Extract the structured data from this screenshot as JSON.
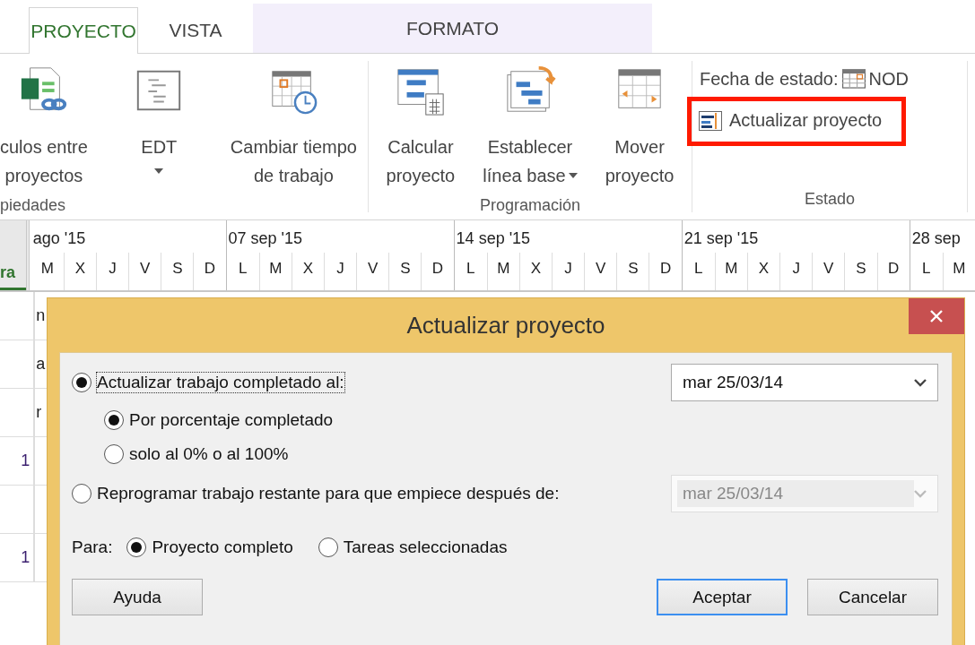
{
  "tabs": [
    {
      "label": "PROYECTO",
      "selected": true,
      "kind": "plain"
    },
    {
      "label": "VISTA",
      "selected": false,
      "kind": "plain"
    },
    {
      "label": "FORMATO",
      "selected": false,
      "kind": "context"
    }
  ],
  "ribbon": {
    "groups": [
      {
        "label": "piedades",
        "commands": [
          {
            "lines": [
              "culos entre",
              "proyectos"
            ],
            "dropdown": false
          },
          {
            "lines": [
              "EDT"
            ],
            "dropdown": true
          },
          {
            "lines": [
              "Cambiar tiempo",
              "de trabajo"
            ],
            "dropdown": false
          }
        ]
      },
      {
        "label": "Programación",
        "commands": [
          {
            "lines": [
              "Calcular",
              "proyecto"
            ],
            "dropdown": false
          },
          {
            "lines": [
              "Establecer",
              "línea base"
            ],
            "dropdown": true
          },
          {
            "lines": [
              "Mover",
              "proyecto"
            ],
            "dropdown": false
          }
        ]
      }
    ],
    "status": {
      "label": "Estado",
      "date_label": "Fecha de estado:",
      "date_value": "NOD",
      "update_button": {
        "label": "Actualizar proyecto",
        "highlighted": true
      }
    }
  },
  "timescale": {
    "left_header": "ra",
    "weeks": [
      {
        "label": "ago '15",
        "days": [
          "M",
          "X",
          "J",
          "V",
          "S",
          "D"
        ]
      },
      {
        "label": "07 sep '15",
        "days": [
          "L",
          "M",
          "X",
          "J",
          "V",
          "S",
          "D"
        ]
      },
      {
        "label": "14 sep '15",
        "days": [
          "L",
          "M",
          "X",
          "J",
          "V",
          "S",
          "D"
        ]
      },
      {
        "label": "21 sep '15",
        "days": [
          "L",
          "M",
          "X",
          "J",
          "V",
          "S",
          "D"
        ]
      },
      {
        "label": "28 sep",
        "days": [
          "L",
          "M"
        ]
      }
    ]
  },
  "rows": [
    {
      "column_1": "",
      "column_2": "n"
    },
    {
      "column_1": "",
      "column_2": "a"
    },
    {
      "column_1": "",
      "column_2": "r"
    },
    {
      "column_1": "1",
      "column_2": ""
    },
    {
      "column_1": "",
      "column_2": ""
    },
    {
      "column_1": "1",
      "column_2": ""
    }
  ],
  "dialog": {
    "title": "Actualizar proyecto",
    "options": [
      {
        "label": "Actualizar trabajo completado al:",
        "selected": true,
        "focused": true,
        "date": {
          "value": "mar 25/03/14",
          "disabled": false
        },
        "sub_options": [
          {
            "label": "Por porcentaje completado",
            "selected": true
          },
          {
            "label": "solo al 0% o al 100%",
            "selected": false
          }
        ]
      },
      {
        "label": "Reprogramar trabajo restante para que empiece después de:",
        "selected": false,
        "focused": false,
        "date": {
          "value": "mar 25/03/14",
          "disabled": true
        }
      }
    ],
    "scope": {
      "label": "Para:",
      "options": [
        {
          "label": "Proyecto completo",
          "selected": true
        },
        {
          "label": "Tareas seleccionadas",
          "selected": false
        }
      ]
    },
    "buttons": [
      {
        "label": "Ayuda",
        "default": false
      },
      {
        "label": "Aceptar",
        "default": true
      },
      {
        "label": "Cancelar",
        "default": false
      }
    ]
  }
}
